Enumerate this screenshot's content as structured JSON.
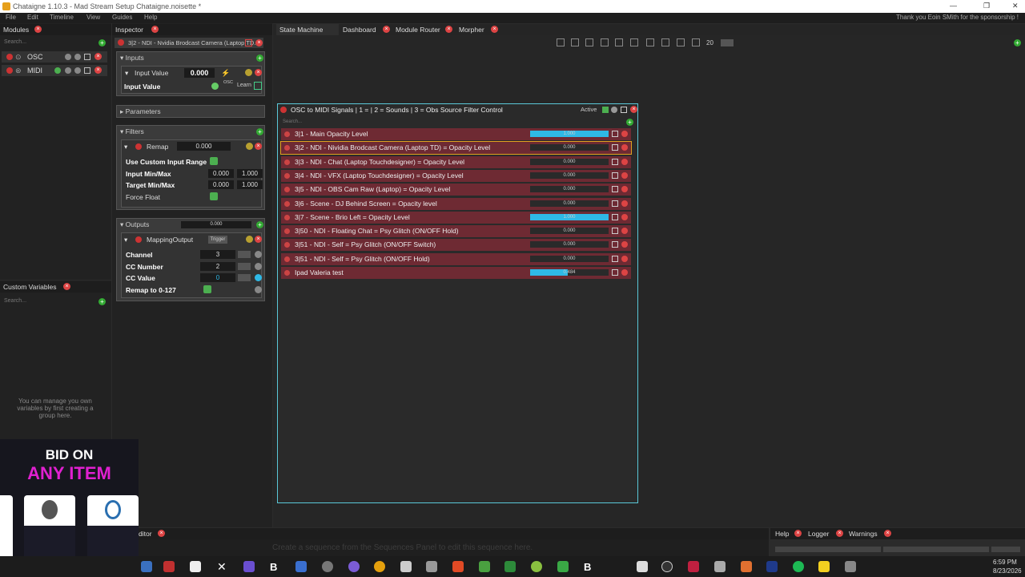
{
  "window": {
    "title": "Chataigne 1.10.3 - Mad Stream Setup Chataigne.noisette *"
  },
  "menu": [
    "File",
    "Edit",
    "Timeline",
    "View",
    "Guides",
    "Help"
  ],
  "sponsor": "Thank you Eoin SMith for the sponsorship !",
  "modules": {
    "tab": "Modules",
    "search": "Search...",
    "items": [
      {
        "label": "OSC"
      },
      {
        "label": "MIDI"
      }
    ]
  },
  "custom_vars": {
    "tab": "Custom Variables",
    "search": "Search...",
    "empty_msg": "You can manage you own variables by first creating a group here."
  },
  "inspector": {
    "tab": "Inspector",
    "header": "3|2 - NDI - Nvidia Brodcast Camera (Laptop TD...",
    "inputs": {
      "title": "Inputs",
      "input_value_label": "Input Value",
      "input_value": "0.000",
      "input_value_bold": "Input Value",
      "osc": "OSC",
      "learn": "Learn"
    },
    "parameters": {
      "title": "Parameters"
    },
    "filters": {
      "title": "Filters",
      "remap_label": "Remap",
      "remap_value": "0.000",
      "use_custom": "Use Custom Input Range",
      "input_minmax": "Input Min/Max",
      "in_min": "0.000",
      "in_max": "1.000",
      "target_minmax": "Target Min/Max",
      "t_min": "0.000",
      "t_max": "1.000",
      "force_float": "Force Float"
    },
    "outputs": {
      "title": "Outputs",
      "value": "0.000",
      "mapping_output": "MappingOutput",
      "trigger": "Trigger",
      "channel": "Channel",
      "channel_val": "3",
      "cc_number": "CC Number",
      "cc_number_val": "2",
      "cc_value": "CC Value",
      "cc_value_val": "0",
      "remap": "Remap to 0-127"
    }
  },
  "tabs": [
    "State Machine",
    "Dashboard",
    "Module Router",
    "Morpher"
  ],
  "zoom": "20",
  "state_node": {
    "title": "OSC to MIDI Signals | 1 =  | 2 = Sounds | 3 = Obs Source Filter Control",
    "active": "Active",
    "search": "Search...",
    "rows": [
      {
        "label": "3|1 - Main Opacity Level",
        "value": "1.000",
        "fill": 1.0
      },
      {
        "label": "3|2 - NDI - Nividia Brodcast Camera (Laptop TD) = Opacity Level",
        "value": "0.000",
        "fill": 0.0,
        "selected": true
      },
      {
        "label": "3|3 - NDI - Chat (Laptop Touchdesigner) = Opacity Level",
        "value": "0.000",
        "fill": 0.0
      },
      {
        "label": "3|4 - NDI - VFX (Laptop Touchdesigner) = Opacity Level",
        "value": "0.000",
        "fill": 0.0
      },
      {
        "label": "3|5 - NDI - OBS Cam Raw (Laptop) = Opacity Level",
        "value": "0.000",
        "fill": 0.0
      },
      {
        "label": "3|6 - Scene - DJ Behind Screen = Opacity level",
        "value": "0.000",
        "fill": 0.0
      },
      {
        "label": "3|7 - Scene - Brio Left = Opacity Level",
        "value": "1.000",
        "fill": 1.0
      },
      {
        "label": "3|50 - NDI - Floating Chat = Psy Glitch (ON/OFF Hold)",
        "value": "0.000",
        "fill": 0.0
      },
      {
        "label": "3|51 - NDI - Self = Psy Glitch (ON/OFF Switch)",
        "value": "0.000",
        "fill": 0.0
      },
      {
        "label": "3|51 - NDI - Self = Psy Glitch (ON/OFF Hold)",
        "value": "0.000",
        "fill": 0.0
      },
      {
        "label": "Ipad Valeria test",
        "value": "0.484",
        "fill": 0.484
      }
    ]
  },
  "bottom": {
    "editor_tab": "ditor",
    "sequence_hint": "Create a sequence from the Sequences Panel to edit this sequence here.",
    "right_tabs": [
      "Help",
      "Logger",
      "Warnings"
    ]
  },
  "ad": {
    "line1": "BID ON",
    "line2": "ANY ITEM"
  },
  "clock": {
    "time": "6:59 PM",
    "date": "8/23/2026"
  }
}
